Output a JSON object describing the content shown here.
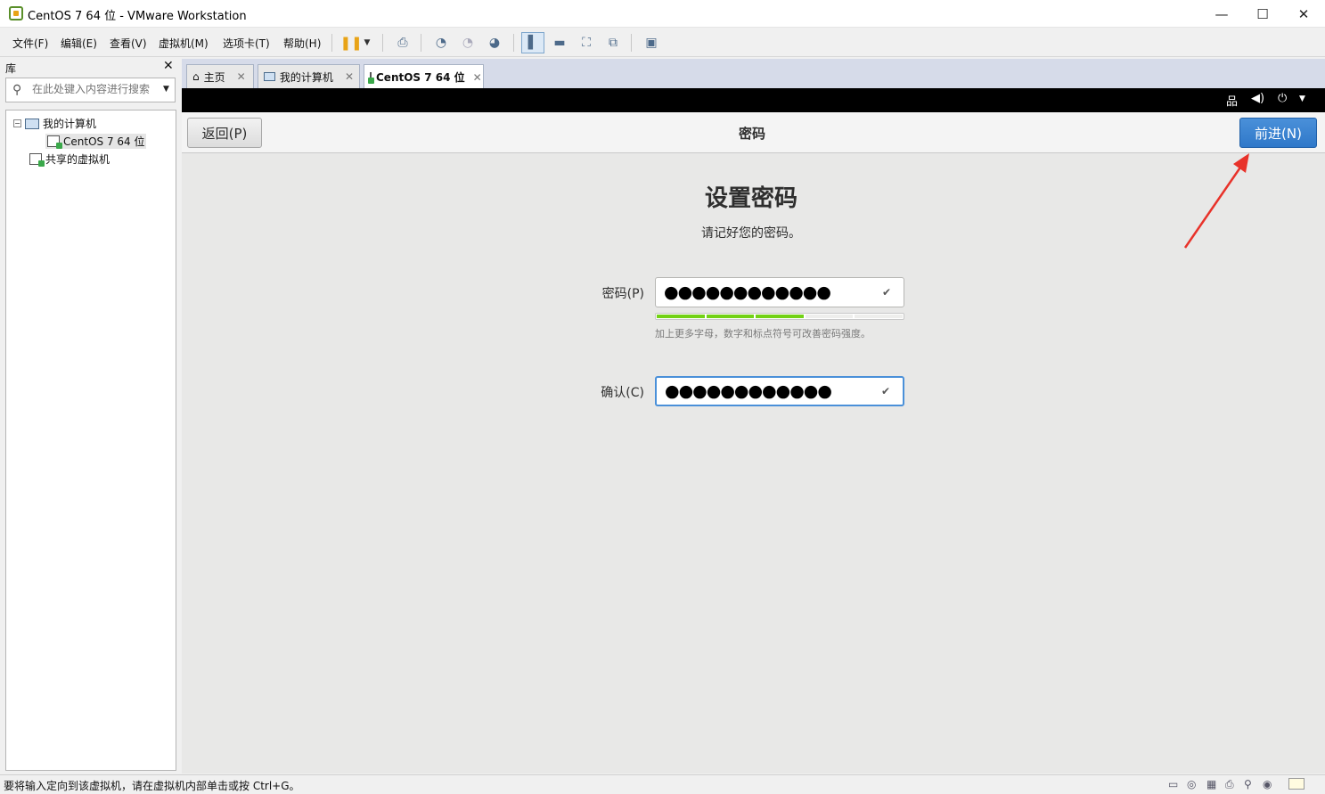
{
  "window": {
    "title": "CentOS 7 64 位 - VMware Workstation",
    "minimize": "—",
    "maximize": "☐",
    "close": "✕"
  },
  "menu": {
    "file": "文件(F)",
    "edit": "编辑(E)",
    "view": "查看(V)",
    "vm": "虚拟机(M)",
    "tabs": "选项卡(T)",
    "help": "帮助(H)"
  },
  "library": {
    "title": "库",
    "close": "✕",
    "search_placeholder": "在此处键入内容进行搜索",
    "tree": {
      "my_computer": "我的计算机",
      "vm": "CentOS 7 64 位",
      "shared": "共享的虚拟机"
    }
  },
  "tabs": [
    {
      "label": "主页",
      "close": "✕"
    },
    {
      "label": "我的计算机",
      "close": "✕"
    },
    {
      "label": "CentOS 7 64 位",
      "close": "✕"
    }
  ],
  "anaconda": {
    "back_label": "返回(P)",
    "header_title": "密码",
    "next_label": "前进(N)",
    "main_title": "设置密码",
    "subtitle": "请记好您的密码。",
    "password_label": "密码(P)",
    "password_value": "●●●●●●●●●●●●",
    "confirm_label": "确认(C)",
    "confirm_value": "●●●●●●●●●●●●",
    "hint": "加上更多字母，数字和标点符号可改善密码强度。",
    "strength_level": 0.6,
    "strength_color": "#73d216"
  },
  "statusbar": {
    "text": "要将输入定向到该虚拟机，请在虚拟机内部单击或按 Ctrl+G。"
  },
  "colors": {
    "accent": "#4a90d9",
    "annotation_arrow": "#e8322a"
  }
}
